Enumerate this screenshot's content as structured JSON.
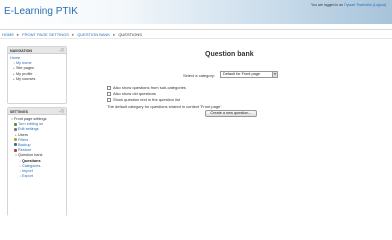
{
  "site": {
    "title": "E-Learning PTIK"
  },
  "login": {
    "prefix": "You are logged in as",
    "user": "Trywart Tharindhu",
    "logout": "(Logout)"
  },
  "breadcrumb": [
    "HOME",
    "FRONT PAGE SETTINGS",
    "QUESTION BANK",
    "QUESTIONS"
  ],
  "navigation": {
    "title": "NAVIGATION",
    "items": [
      "Home",
      "My home",
      "Site pages",
      "My profile",
      "My courses"
    ]
  },
  "settings": {
    "title": "SETTINGS",
    "items": [
      "Front page settings",
      "Turn editing on",
      "Edit settings",
      "Users",
      "Filters",
      "Backup",
      "Restore",
      "Question bank",
      "Questions",
      "Categories",
      "Import",
      "Export"
    ]
  },
  "main": {
    "title": "Question bank",
    "category_label": "Select a category:",
    "category_value": "Default for Front page",
    "checkboxes": [
      "Also show questions from sub-categories",
      "Also show old questions",
      "Show question text in the question list"
    ],
    "default_note": "The default category for questions shared in context 'Front page'.",
    "create_button": "Create a new question..."
  }
}
